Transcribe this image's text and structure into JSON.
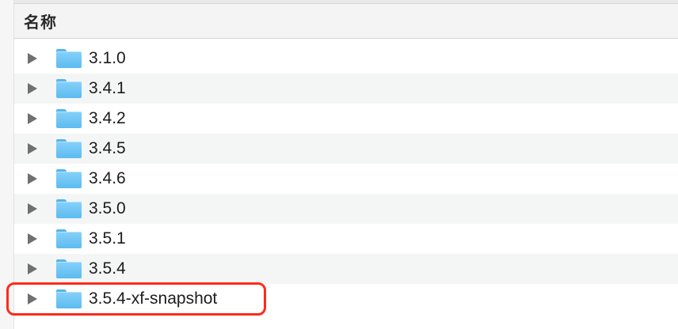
{
  "header": {
    "name_label": "名称"
  },
  "accent": {
    "highlight": "#ff2a1a",
    "folder": "#5cbcf0"
  },
  "rows": [
    {
      "name": "3.1.0",
      "icon": "folder-icon"
    },
    {
      "name": "3.4.1",
      "icon": "folder-icon"
    },
    {
      "name": "3.4.2",
      "icon": "folder-icon"
    },
    {
      "name": "3.4.5",
      "icon": "folder-icon"
    },
    {
      "name": "3.4.6",
      "icon": "folder-icon"
    },
    {
      "name": "3.5.0",
      "icon": "folder-icon"
    },
    {
      "name": "3.5.1",
      "icon": "folder-icon"
    },
    {
      "name": "3.5.4",
      "icon": "folder-icon"
    },
    {
      "name": "3.5.4-xf-snapshot",
      "icon": "folder-icon",
      "highlighted": true
    }
  ]
}
